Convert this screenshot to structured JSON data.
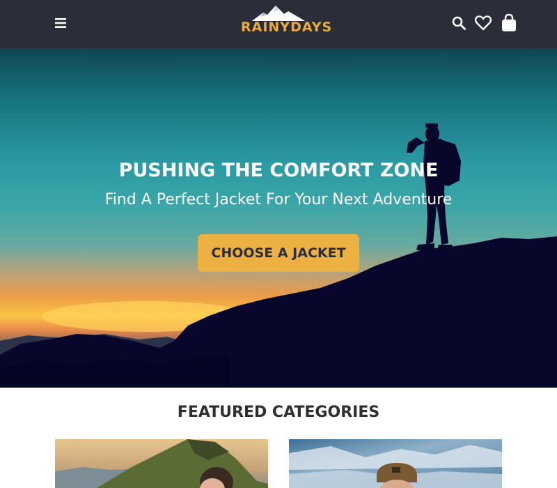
{
  "header": {
    "menu_icon": "hamburger-menu-icon",
    "logo_text": "RAINYDAYS",
    "icons": [
      "search-icon",
      "heart-icon",
      "shopping-bag-icon"
    ]
  },
  "hero": {
    "title": "PUSHING THE COMFORT ZONE",
    "subtitle": "Find A Perfect Jacket For Your Next Adventure",
    "cta_label": "CHOOSE A JACKET"
  },
  "featured": {
    "title": "FEATURED CATEGORIES"
  },
  "colors": {
    "header_bg": "#2b2d39",
    "accent": "#ecb142",
    "logo": "#e9ad3e"
  }
}
